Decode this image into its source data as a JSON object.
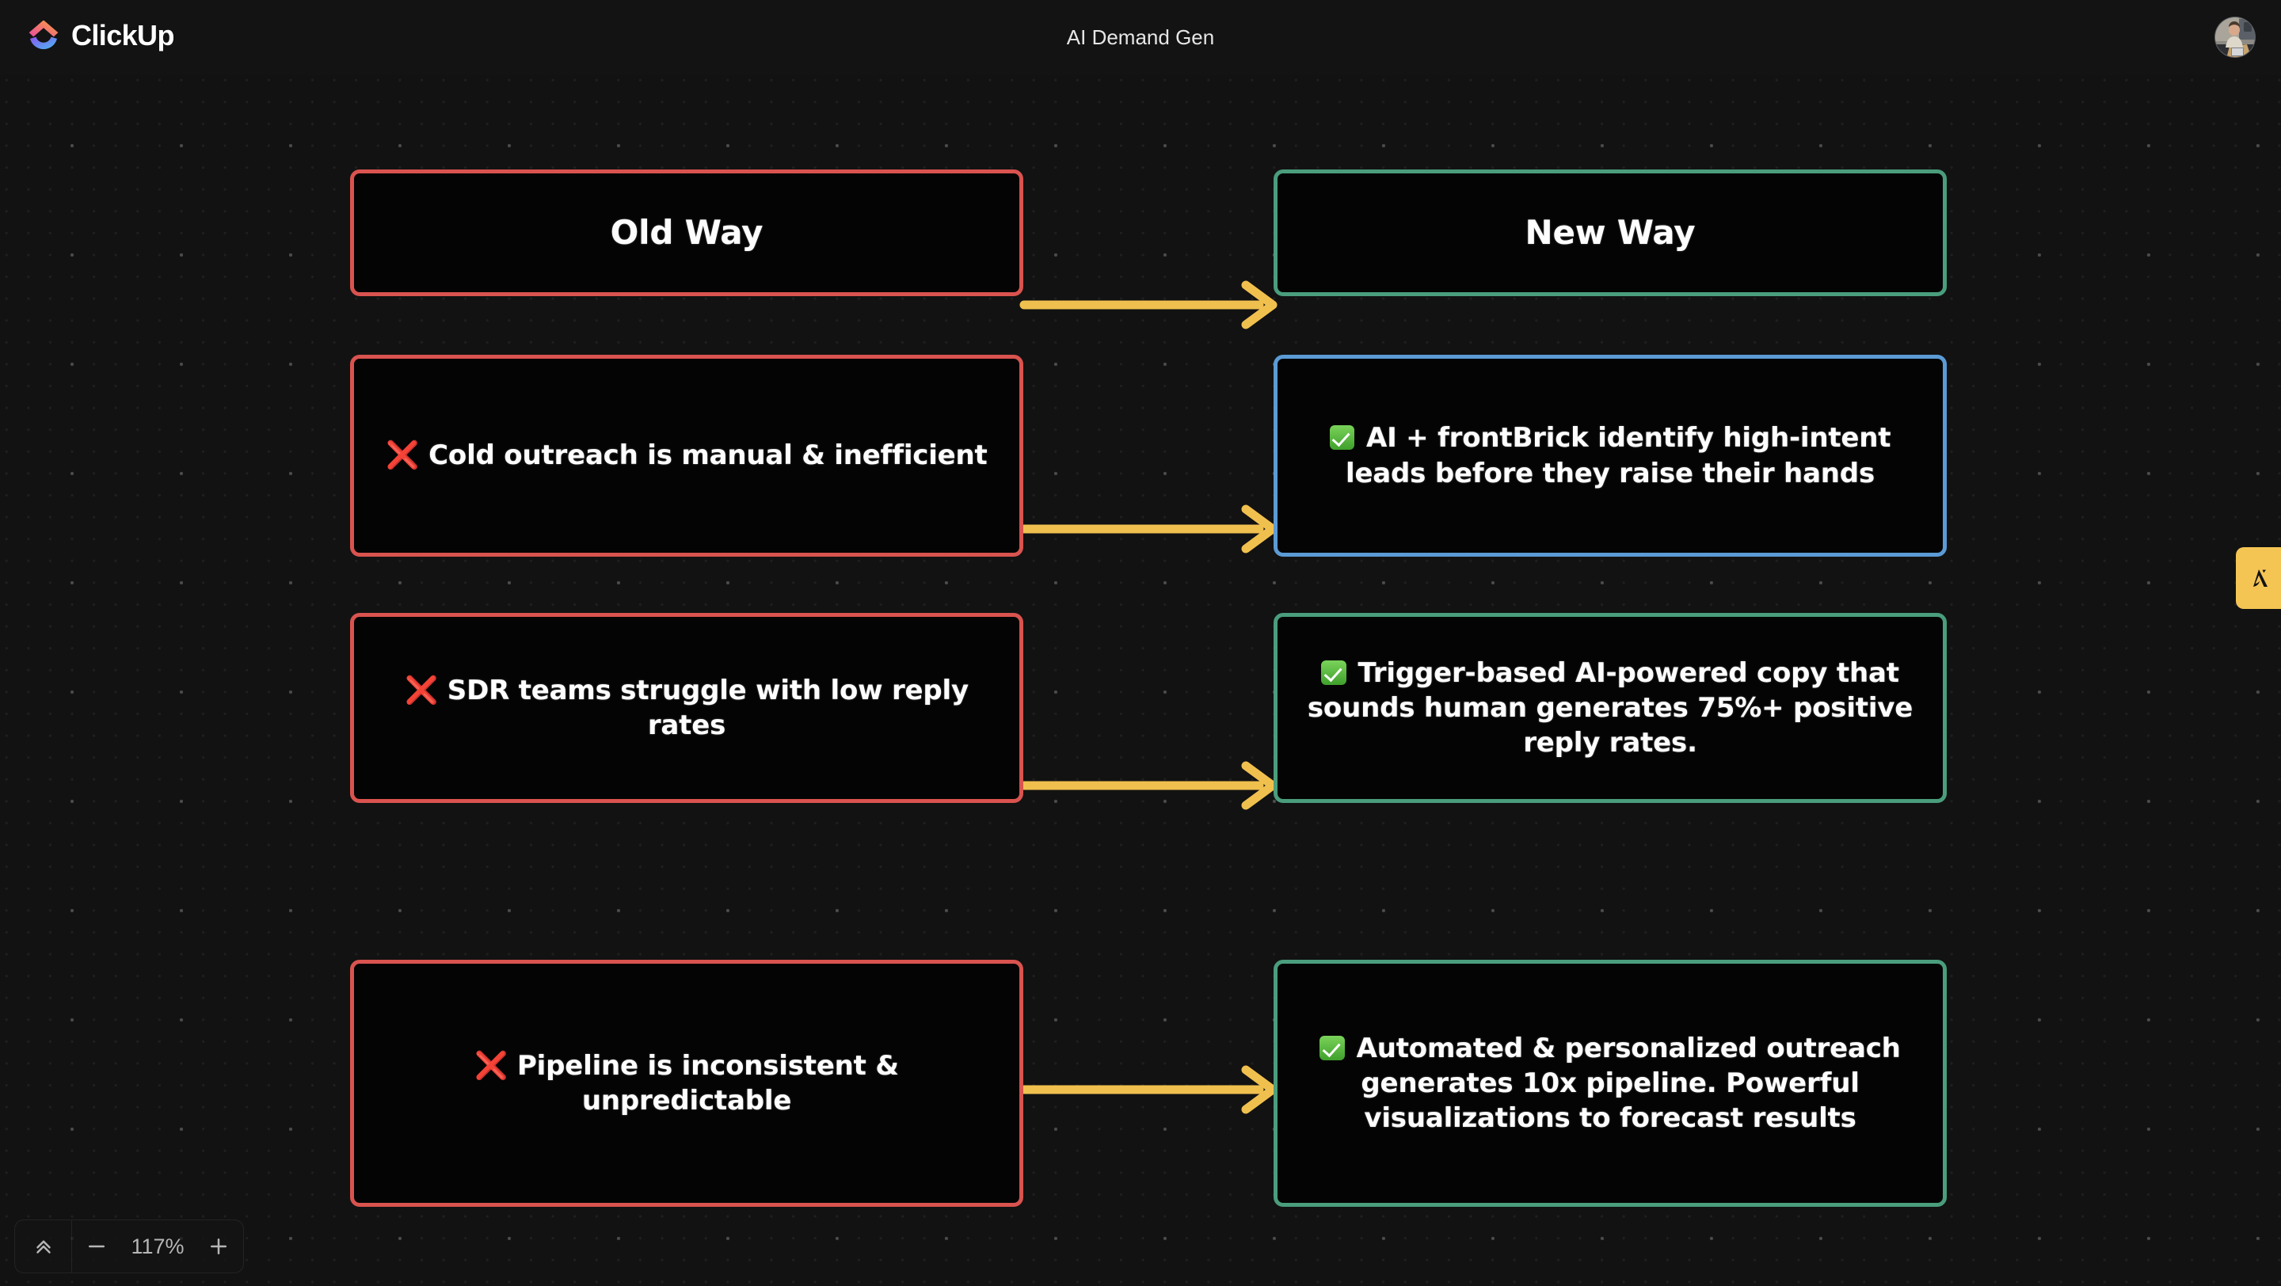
{
  "app": {
    "brand_name": "ClickUp",
    "document_title": "AI Demand Gen",
    "accent_red": "#d9534f",
    "accent_green": "#4a9d7d",
    "accent_blue": "#5b9bd5",
    "accent_arrow": "#f0c04f",
    "canvas_bg": "#121212"
  },
  "header": {
    "logo_icon": "clickup-logo-icon",
    "avatar_label": "user-avatar"
  },
  "board": {
    "columns": [
      {
        "id": "left",
        "heading": "Old Way"
      },
      {
        "id": "right",
        "heading": "New Way"
      }
    ],
    "nodes": [
      {
        "id": "old-way",
        "text": "Old Way",
        "color": "red",
        "emoji": "none"
      },
      {
        "id": "new-way",
        "text": "New Way",
        "color": "green",
        "emoji": "none"
      },
      {
        "id": "pain-1",
        "text": "Cold outreach is manual & inefficient",
        "color": "red",
        "emoji": "cross-mark"
      },
      {
        "id": "gain-1",
        "text": "AI + frontBrick identify high-intent leads before they raise their hands",
        "color": "blue",
        "emoji": "check-mark-button"
      },
      {
        "id": "pain-2",
        "text": "SDR teams struggle with low reply rates",
        "color": "red",
        "emoji": "cross-mark"
      },
      {
        "id": "gain-2",
        "text": "Trigger-based AI-powered copy that sounds human generates 75%+ positive reply rates.",
        "color": "green",
        "emoji": "check-mark-button"
      },
      {
        "id": "pain-3",
        "text": "Pipeline is inconsistent & unpredictable",
        "color": "red",
        "emoji": "cross-mark"
      },
      {
        "id": "gain-3",
        "text": "Automated & personalized outreach generates 10x pipeline. Powerful visualizations to forecast results",
        "color": "green",
        "emoji": "check-mark-button"
      }
    ],
    "connectors": [
      {
        "from": "old-way",
        "to": "new-way",
        "icon": "arrow-right-icon"
      },
      {
        "from": "pain-1",
        "to": "gain-1",
        "icon": "arrow-right-icon"
      },
      {
        "from": "pain-2",
        "to": "gain-2",
        "icon": "arrow-right-icon"
      },
      {
        "from": "pain-3",
        "to": "gain-3",
        "icon": "arrow-right-icon"
      }
    ]
  },
  "side_tab": {
    "icon": "apollo-logo-icon"
  },
  "toolbar": {
    "collapse_icon": "chevrons-up-icon",
    "zoom_out_icon": "minus-icon",
    "zoom_in_icon": "plus-icon",
    "zoom_out_label": "−",
    "zoom_in_label": "+",
    "zoom_level": "117%"
  }
}
